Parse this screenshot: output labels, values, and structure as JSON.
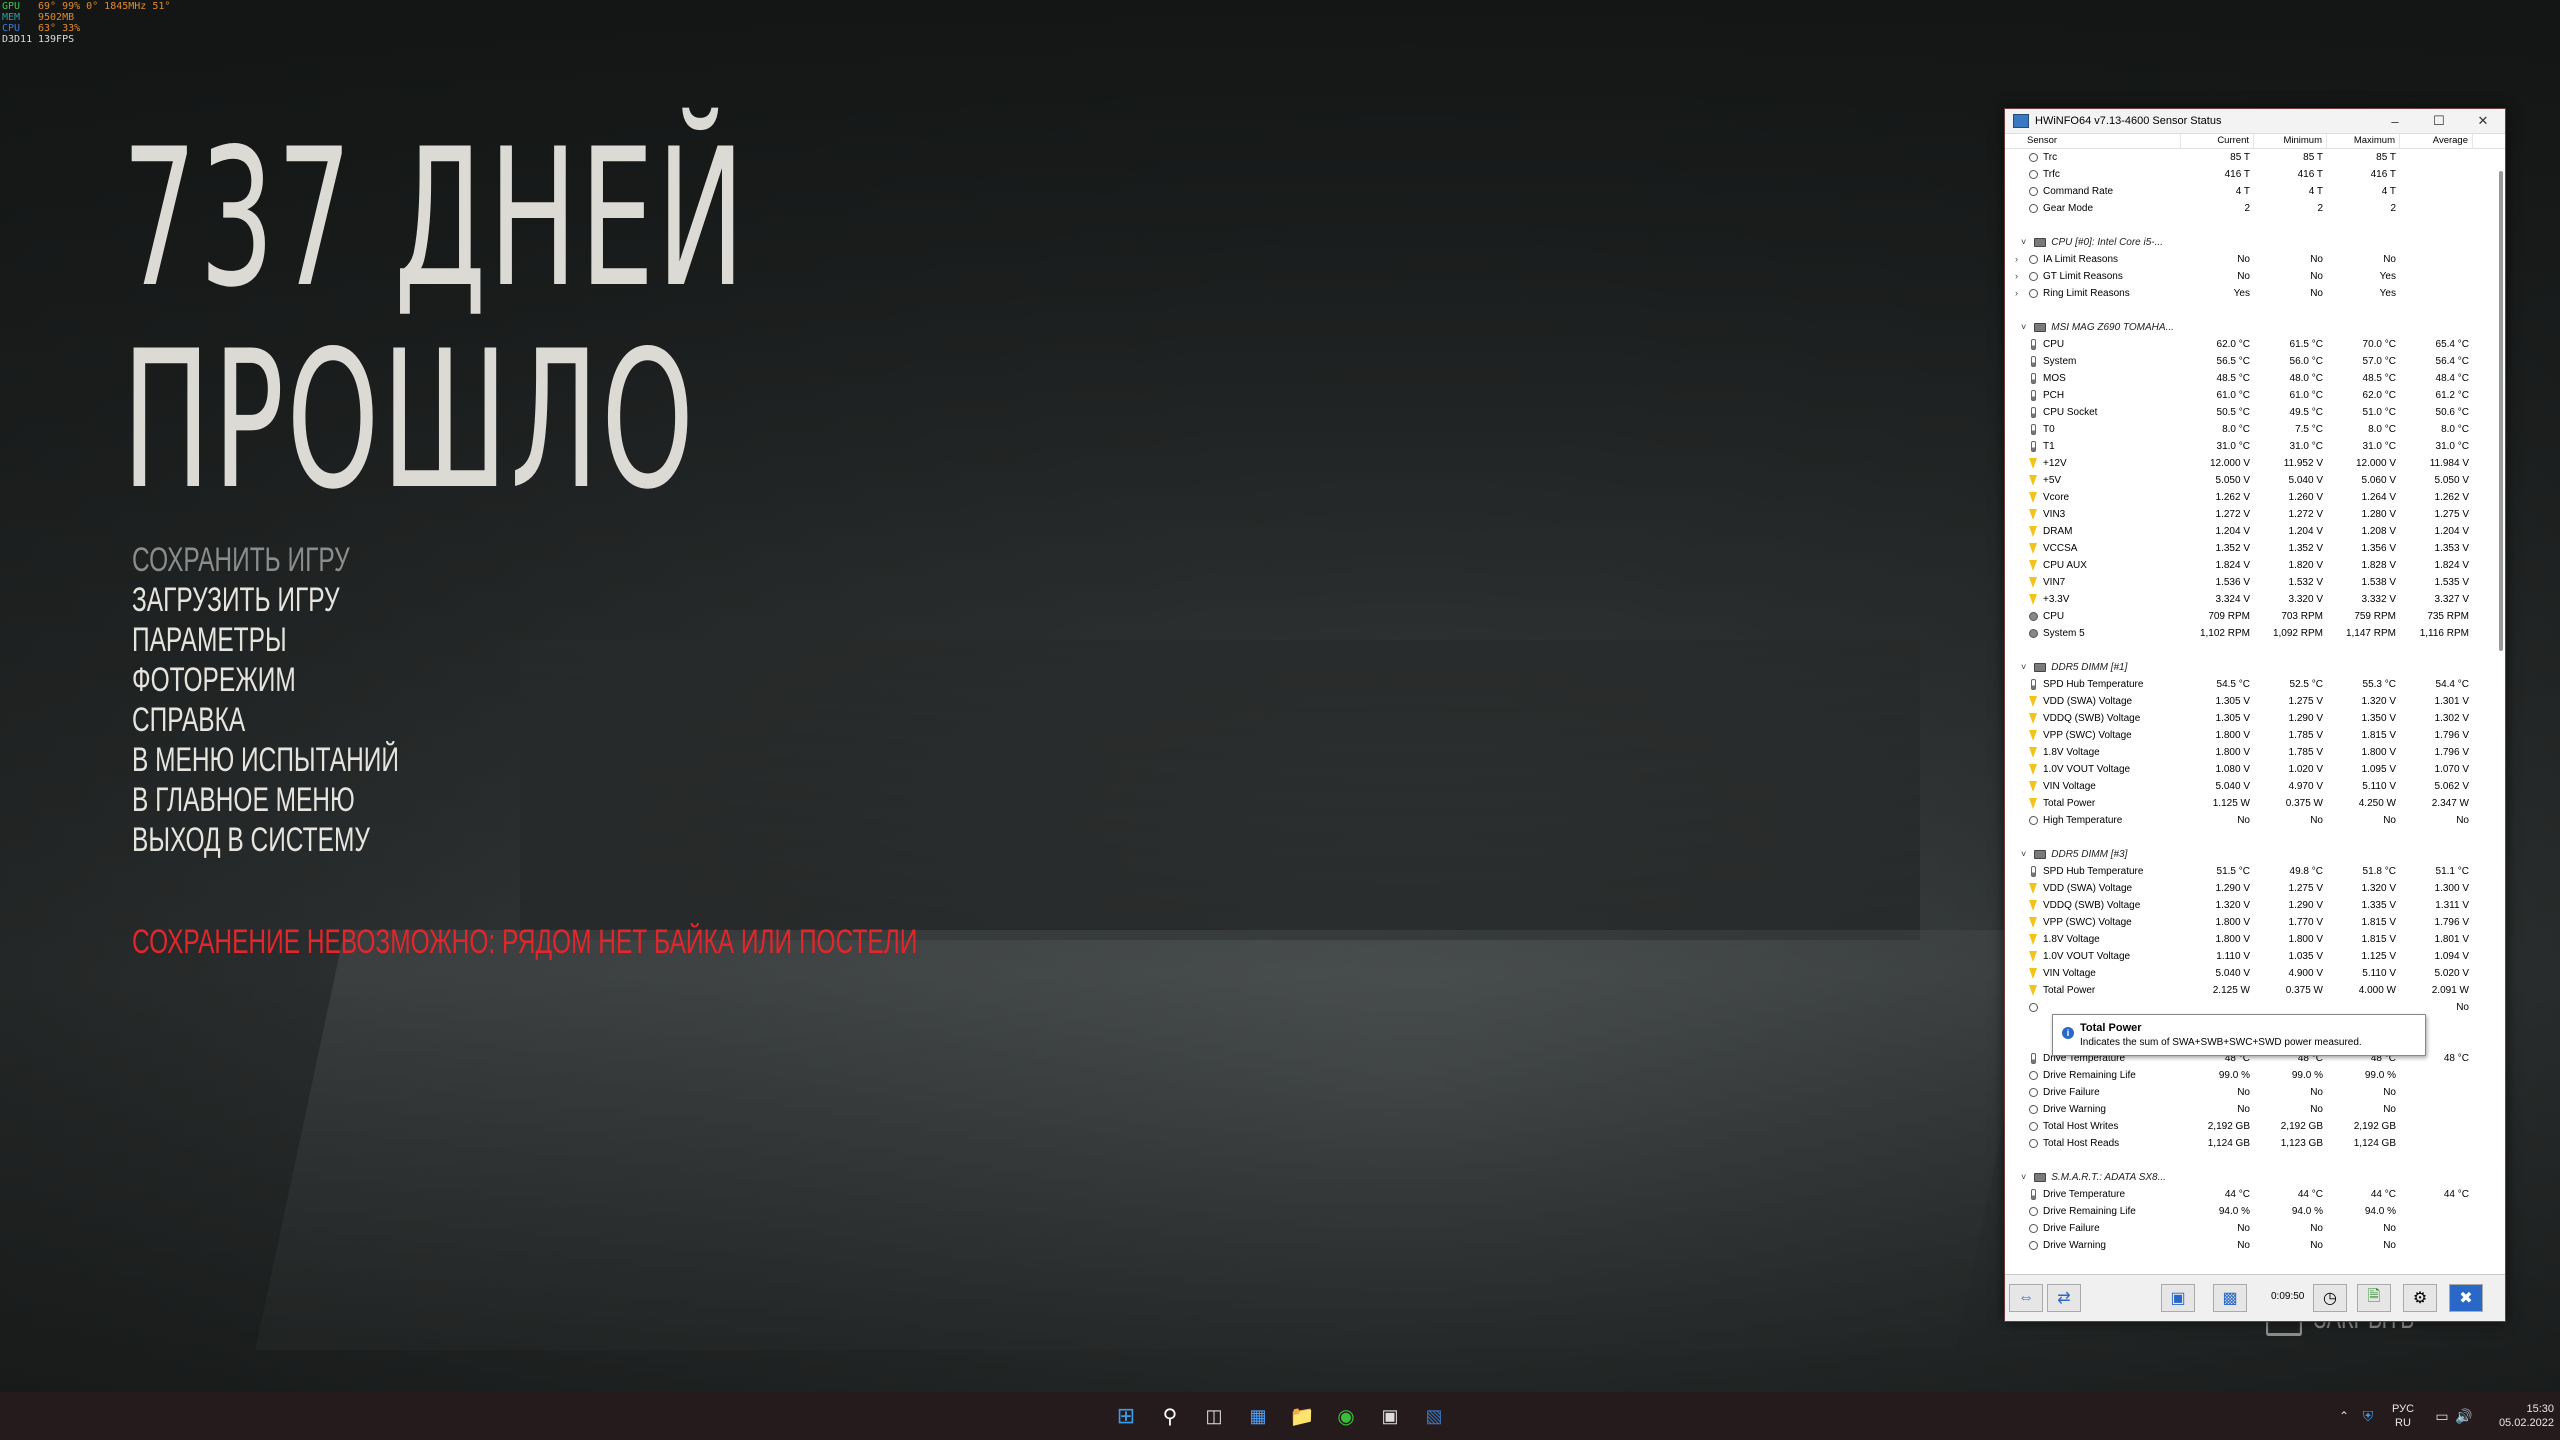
{
  "osd": [
    {
      "k": "GPU",
      "v": [
        "69°",
        "99%",
        "0°",
        "1845MHz",
        "51°"
      ]
    },
    {
      "k": "MEM",
      "v": [
        "9502MB"
      ]
    },
    {
      "k": "CPU",
      "v": [
        "63°",
        "33%"
      ]
    },
    {
      "k": "D3D11",
      "v": [
        "139FPS"
      ]
    }
  ],
  "game": {
    "title_line1": "737 ДНЕЙ",
    "title_line2": "ПРОШЛО",
    "menu": [
      {
        "label": "СОХРАНИТЬ ИГРУ",
        "disabled": true
      },
      {
        "label": "ЗАГРУЗИТЬ ИГРУ"
      },
      {
        "label": "ПАРАМЕТРЫ"
      },
      {
        "label": "ФОТОРЕЖИМ"
      },
      {
        "label": "СПРАВКА"
      },
      {
        "label": "В МЕНЮ ИСПЫТАНИЙ"
      },
      {
        "label": "В ГЛАВНОЕ МЕНЮ"
      },
      {
        "label": "ВЫХОД В СИСТЕМУ"
      }
    ],
    "warning": "СОХРАНЕНИЕ НЕВОЗМОЖНО: РЯДОМ НЕТ БАЙКА ИЛИ ПОСТЕЛИ",
    "close_label": "ЗАКРЫТЬ"
  },
  "hwinfo": {
    "window_title": "HWiNFO64 v7.13-4600 Sensor Status",
    "columns": [
      "Sensor",
      "Current",
      "Minimum",
      "Maximum",
      "Average"
    ],
    "timer": "0:09:50",
    "tooltip": {
      "title": "Total Power",
      "text": "Indicates the sum of SWA+SWB+SWC+SWD power measured."
    },
    "rows": [
      {
        "t": "s",
        "i": "dot",
        "n": "Trc",
        "v": [
          "85 T",
          "85 T",
          "85 T",
          ""
        ]
      },
      {
        "t": "s",
        "i": "dot",
        "n": "Trfc",
        "v": [
          "416 T",
          "416 T",
          "416 T",
          ""
        ]
      },
      {
        "t": "s",
        "i": "dot",
        "n": "Command Rate",
        "v": [
          "4 T",
          "4 T",
          "4 T",
          ""
        ]
      },
      {
        "t": "s",
        "i": "dot",
        "n": "Gear Mode",
        "v": [
          "2",
          "2",
          "2",
          ""
        ]
      },
      {
        "t": "b"
      },
      {
        "t": "g",
        "n": "CPU [#0]: Intel Core i5-..."
      },
      {
        "t": "s",
        "i": "dot",
        "e": true,
        "n": "IA Limit Reasons",
        "v": [
          "No",
          "No",
          "No",
          ""
        ]
      },
      {
        "t": "s",
        "i": "dot",
        "e": true,
        "n": "GT Limit Reasons",
        "v": [
          "No",
          "No",
          "Yes",
          ""
        ]
      },
      {
        "t": "s",
        "i": "dot",
        "e": true,
        "n": "Ring Limit Reasons",
        "v": [
          "Yes",
          "No",
          "Yes",
          ""
        ]
      },
      {
        "t": "b"
      },
      {
        "t": "g",
        "n": "MSI MAG Z690 TOMAHA..."
      },
      {
        "t": "s",
        "i": "temp",
        "n": "CPU",
        "v": [
          "62.0 °C",
          "61.5 °C",
          "70.0 °C",
          "65.4 °C"
        ]
      },
      {
        "t": "s",
        "i": "temp",
        "n": "System",
        "v": [
          "56.5 °C",
          "56.0 °C",
          "57.0 °C",
          "56.4 °C"
        ]
      },
      {
        "t": "s",
        "i": "temp",
        "n": "MOS",
        "v": [
          "48.5 °C",
          "48.0 °C",
          "48.5 °C",
          "48.4 °C"
        ]
      },
      {
        "t": "s",
        "i": "temp",
        "n": "PCH",
        "v": [
          "61.0 °C",
          "61.0 °C",
          "62.0 °C",
          "61.2 °C"
        ]
      },
      {
        "t": "s",
        "i": "temp",
        "n": "CPU Socket",
        "v": [
          "50.5 °C",
          "49.5 °C",
          "51.0 °C",
          "50.6 °C"
        ]
      },
      {
        "t": "s",
        "i": "temp",
        "n": "T0",
        "v": [
          "8.0 °C",
          "7.5 °C",
          "8.0 °C",
          "8.0 °C"
        ]
      },
      {
        "t": "s",
        "i": "temp",
        "n": "T1",
        "v": [
          "31.0 °C",
          "31.0 °C",
          "31.0 °C",
          "31.0 °C"
        ]
      },
      {
        "t": "s",
        "i": "volt",
        "n": "+12V",
        "v": [
          "12.000 V",
          "11.952 V",
          "12.000 V",
          "11.984 V"
        ]
      },
      {
        "t": "s",
        "i": "volt",
        "n": "+5V",
        "v": [
          "5.050 V",
          "5.040 V",
          "5.060 V",
          "5.050 V"
        ]
      },
      {
        "t": "s",
        "i": "volt",
        "n": "Vcore",
        "v": [
          "1.262 V",
          "1.260 V",
          "1.264 V",
          "1.262 V"
        ]
      },
      {
        "t": "s",
        "i": "volt",
        "n": "VIN3",
        "v": [
          "1.272 V",
          "1.272 V",
          "1.280 V",
          "1.275 V"
        ]
      },
      {
        "t": "s",
        "i": "volt",
        "n": "DRAM",
        "v": [
          "1.204 V",
          "1.204 V",
          "1.208 V",
          "1.204 V"
        ]
      },
      {
        "t": "s",
        "i": "volt",
        "n": "VCCSA",
        "v": [
          "1.352 V",
          "1.352 V",
          "1.356 V",
          "1.353 V"
        ]
      },
      {
        "t": "s",
        "i": "volt",
        "n": "CPU AUX",
        "v": [
          "1.824 V",
          "1.820 V",
          "1.828 V",
          "1.824 V"
        ]
      },
      {
        "t": "s",
        "i": "volt",
        "n": "VIN7",
        "v": [
          "1.536 V",
          "1.532 V",
          "1.538 V",
          "1.535 V"
        ]
      },
      {
        "t": "s",
        "i": "volt",
        "n": "+3.3V",
        "v": [
          "3.324 V",
          "3.320 V",
          "3.332 V",
          "3.327 V"
        ]
      },
      {
        "t": "s",
        "i": "fan",
        "n": "CPU",
        "v": [
          "709 RPM",
          "703 RPM",
          "759 RPM",
          "735 RPM"
        ]
      },
      {
        "t": "s",
        "i": "fan",
        "n": "System 5",
        "v": [
          "1,102 RPM",
          "1,092 RPM",
          "1,147 RPM",
          "1,116 RPM"
        ]
      },
      {
        "t": "b"
      },
      {
        "t": "g",
        "n": "DDR5 DIMM [#1]"
      },
      {
        "t": "s",
        "i": "temp",
        "n": "SPD Hub Temperature",
        "v": [
          "54.5 °C",
          "52.5 °C",
          "55.3 °C",
          "54.4 °C"
        ]
      },
      {
        "t": "s",
        "i": "volt",
        "n": "VDD (SWA) Voltage",
        "v": [
          "1.305 V",
          "1.275 V",
          "1.320 V",
          "1.301 V"
        ]
      },
      {
        "t": "s",
        "i": "volt",
        "n": "VDDQ (SWB) Voltage",
        "v": [
          "1.305 V",
          "1.290 V",
          "1.350 V",
          "1.302 V"
        ]
      },
      {
        "t": "s",
        "i": "volt",
        "n": "VPP (SWC) Voltage",
        "v": [
          "1.800 V",
          "1.785 V",
          "1.815 V",
          "1.796 V"
        ]
      },
      {
        "t": "s",
        "i": "volt",
        "n": "1.8V Voltage",
        "v": [
          "1.800 V",
          "1.785 V",
          "1.800 V",
          "1.796 V"
        ]
      },
      {
        "t": "s",
        "i": "volt",
        "n": "1.0V VOUT Voltage",
        "v": [
          "1.080 V",
          "1.020 V",
          "1.095 V",
          "1.070 V"
        ]
      },
      {
        "t": "s",
        "i": "volt",
        "n": "VIN Voltage",
        "v": [
          "5.040 V",
          "4.970 V",
          "5.110 V",
          "5.062 V"
        ]
      },
      {
        "t": "s",
        "i": "volt",
        "n": "Total Power",
        "v": [
          "1.125 W",
          "0.375 W",
          "4.250 W",
          "2.347 W"
        ]
      },
      {
        "t": "s",
        "i": "dot",
        "n": "High Temperature",
        "v": [
          "No",
          "No",
          "No",
          "No"
        ]
      },
      {
        "t": "b"
      },
      {
        "t": "g",
        "n": "DDR5 DIMM [#3]"
      },
      {
        "t": "s",
        "i": "temp",
        "n": "SPD Hub Temperature",
        "v": [
          "51.5 °C",
          "49.8 °C",
          "51.8 °C",
          "51.1 °C"
        ]
      },
      {
        "t": "s",
        "i": "volt",
        "n": "VDD (SWA) Voltage",
        "v": [
          "1.290 V",
          "1.275 V",
          "1.320 V",
          "1.300 V"
        ]
      },
      {
        "t": "s",
        "i": "volt",
        "n": "VDDQ (SWB) Voltage",
        "v": [
          "1.320 V",
          "1.290 V",
          "1.335 V",
          "1.311 V"
        ]
      },
      {
        "t": "s",
        "i": "volt",
        "n": "VPP (SWC) Voltage",
        "v": [
          "1.800 V",
          "1.770 V",
          "1.815 V",
          "1.796 V"
        ]
      },
      {
        "t": "s",
        "i": "volt",
        "n": "1.8V Voltage",
        "v": [
          "1.800 V",
          "1.800 V",
          "1.815 V",
          "1.801 V"
        ]
      },
      {
        "t": "s",
        "i": "volt",
        "n": "1.0V VOUT Voltage",
        "v": [
          "1.110 V",
          "1.035 V",
          "1.125 V",
          "1.094 V"
        ]
      },
      {
        "t": "s",
        "i": "volt",
        "n": "VIN Voltage",
        "v": [
          "5.040 V",
          "4.900 V",
          "5.110 V",
          "5.020 V"
        ]
      },
      {
        "t": "s",
        "i": "volt",
        "n": "Total Power",
        "v": [
          "2.125 W",
          "0.375 W",
          "4.000 W",
          "2.091 W"
        ]
      },
      {
        "t": "s",
        "i": "dot",
        "n": "",
        "v": [
          "",
          "",
          "",
          "No"
        ]
      },
      {
        "t": "b"
      },
      {
        "t": "b"
      },
      {
        "t": "s",
        "i": "temp",
        "n": "Drive Temperature",
        "v": [
          "48 °C",
          "48 °C",
          "48 °C",
          "48 °C"
        ]
      },
      {
        "t": "s",
        "i": "dot",
        "n": "Drive Remaining Life",
        "v": [
          "99.0 %",
          "99.0 %",
          "99.0 %",
          ""
        ]
      },
      {
        "t": "s",
        "i": "dot",
        "n": "Drive Failure",
        "v": [
          "No",
          "No",
          "No",
          ""
        ]
      },
      {
        "t": "s",
        "i": "dot",
        "n": "Drive Warning",
        "v": [
          "No",
          "No",
          "No",
          ""
        ]
      },
      {
        "t": "s",
        "i": "dot",
        "n": "Total Host Writes",
        "v": [
          "2,192 GB",
          "2,192 GB",
          "2,192 GB",
          ""
        ]
      },
      {
        "t": "s",
        "i": "dot",
        "n": "Total Host Reads",
        "v": [
          "1,124 GB",
          "1,123 GB",
          "1,124 GB",
          ""
        ]
      },
      {
        "t": "b"
      },
      {
        "t": "g",
        "n": "S.M.A.R.T.: ADATA SX8..."
      },
      {
        "t": "s",
        "i": "temp",
        "n": "Drive Temperature",
        "v": [
          "44 °C",
          "44 °C",
          "44 °C",
          "44 °C"
        ]
      },
      {
        "t": "s",
        "i": "dot",
        "n": "Drive Remaining Life",
        "v": [
          "94.0 %",
          "94.0 %",
          "94.0 %",
          ""
        ]
      },
      {
        "t": "s",
        "i": "dot",
        "n": "Drive Failure",
        "v": [
          "No",
          "No",
          "No",
          ""
        ]
      },
      {
        "t": "s",
        "i": "dot",
        "n": "Drive Warning",
        "v": [
          "No",
          "No",
          "No",
          ""
        ]
      }
    ]
  },
  "taskbar": {
    "lang_line1": "РУС",
    "lang_line2": "RU",
    "time": "15:30",
    "date": "05.02.2022"
  }
}
